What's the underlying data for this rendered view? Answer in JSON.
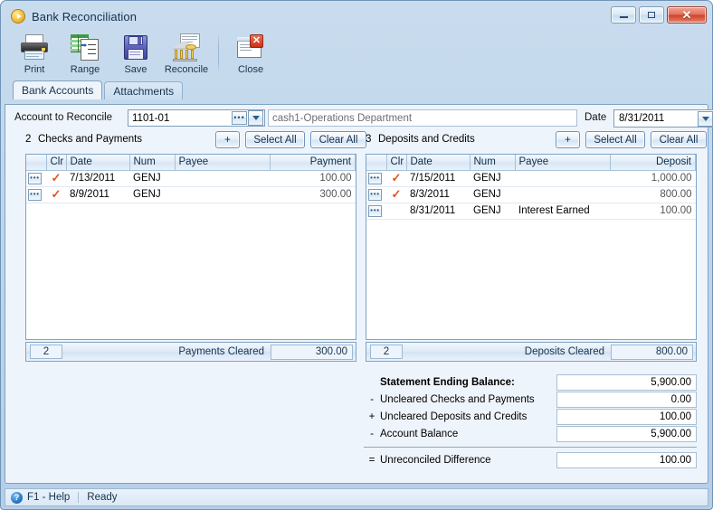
{
  "window": {
    "title": "Bank Reconciliation",
    "app_icon": "app-play-icon",
    "minimize_label": "Minimize",
    "maximize_label": "Maximize",
    "close_label": "Close"
  },
  "toolbar": {
    "items": [
      {
        "label": "Print",
        "icon": "printer-icon"
      },
      {
        "label": "Range",
        "icon": "range-grid-icon"
      },
      {
        "label": "Save",
        "icon": "floppy-disk-icon"
      },
      {
        "label": "Reconcile",
        "icon": "bank-building-icon"
      },
      {
        "label": "Close",
        "icon": "close-window-icon"
      }
    ]
  },
  "tabs": [
    {
      "label": "Bank Accounts",
      "active": true
    },
    {
      "label": "Attachments",
      "active": false
    }
  ],
  "account_row": {
    "account_label": "Account to Reconcile",
    "account_value": "1101-01",
    "account_ellipsis": "•••",
    "account_name": "cash1-Operations Department",
    "date_label": "Date",
    "date_value": "8/31/2011"
  },
  "left_panel": {
    "count": "2",
    "title": "Checks and Payments",
    "add_label": "+",
    "select_all_label": "Select All",
    "clear_all_label": "Clear All",
    "columns": [
      "",
      "Clr",
      "Date",
      "Num",
      "Payee",
      "Payment"
    ],
    "rows": [
      {
        "menu": "•••",
        "cleared": true,
        "date": "7/13/2011",
        "num": "GENJ",
        "payee": "",
        "amount": "100.00"
      },
      {
        "menu": "•••",
        "cleared": true,
        "date": "8/9/2011",
        "num": "GENJ",
        "payee": "",
        "amount": "300.00"
      }
    ],
    "footer_count": "2",
    "footer_label": "Payments Cleared",
    "footer_value": "300.00"
  },
  "right_panel": {
    "count": "3",
    "title": "Deposits and Credits",
    "add_label": "+",
    "select_all_label": "Select All",
    "clear_all_label": "Clear All",
    "columns": [
      "",
      "Clr",
      "Date",
      "Num",
      "Payee",
      "Deposit"
    ],
    "rows": [
      {
        "menu": "•••",
        "cleared": true,
        "date": "7/15/2011",
        "num": "GENJ",
        "payee": "",
        "amount": "1,000.00"
      },
      {
        "menu": "•••",
        "cleared": true,
        "date": "8/3/2011",
        "num": "GENJ",
        "payee": "",
        "amount": "800.00"
      },
      {
        "menu": "•••",
        "cleared": false,
        "date": "8/31/2011",
        "num": "GENJ",
        "payee": "Interest Earned",
        "amount": "100.00"
      }
    ],
    "footer_count": "2",
    "footer_label": "Deposits Cleared",
    "footer_value": "800.00"
  },
  "summary": {
    "rows": [
      {
        "sign": "",
        "label": "Statement Ending Balance:",
        "value": "5,900.00",
        "strong": true
      },
      {
        "sign": "-",
        "label": "Uncleared Checks and Payments",
        "value": "0.00",
        "strong": false
      },
      {
        "sign": "+",
        "label": "Uncleared Deposits and Credits",
        "value": "100.00",
        "strong": false
      },
      {
        "sign": "-",
        "label": "Account Balance",
        "value": "5,900.00",
        "strong": false
      }
    ],
    "total": {
      "sign": "=",
      "label": "Unreconciled Difference",
      "value": "100.00"
    }
  },
  "statusbar": {
    "help_icon": "help-circle-icon",
    "help_label": "F1 - Help",
    "status": "Ready"
  },
  "colors": {
    "accent": "#7fa3c4",
    "panel_bg": "#eef4fb",
    "frame_bg": "#bfd5ea",
    "check_mark": "#e2541d",
    "close_red": "#cd4228"
  }
}
